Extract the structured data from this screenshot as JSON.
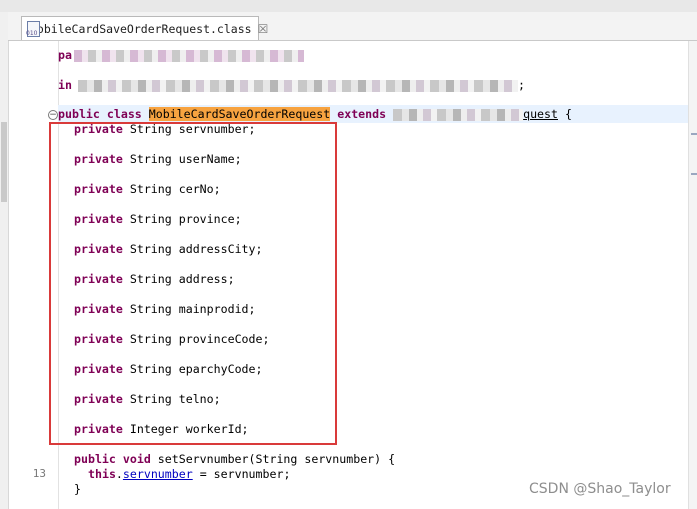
{
  "tab": {
    "label": "MobileCardSaveOrderRequest.class",
    "close_glyph": "☒"
  },
  "editor": {
    "line_package_start": "pa",
    "line_import_start": "in",
    "line_import_end": ";",
    "class_line": {
      "kw_public": "public",
      "kw_class": "class",
      "class_name": "MobileCardSaveOrderRequest",
      "kw_extends": "extends",
      "super_suffix": "quest",
      "brace": "{"
    },
    "fields": [
      {
        "mod": "private",
        "type": "String",
        "name": "servnumber;"
      },
      {
        "mod": "private",
        "type": "String",
        "name": "userName;"
      },
      {
        "mod": "private",
        "type": "String",
        "name": "cerNo;"
      },
      {
        "mod": "private",
        "type": "String",
        "name": "province;"
      },
      {
        "mod": "private",
        "type": "String",
        "name": "addressCity;"
      },
      {
        "mod": "private",
        "type": "String",
        "name": "address;"
      },
      {
        "mod": "private",
        "type": "String",
        "name": "mainprodid;"
      },
      {
        "mod": "private",
        "type": "String",
        "name": "provinceCode;"
      },
      {
        "mod": "private",
        "type": "String",
        "name": "eparchyCode;"
      },
      {
        "mod": "private",
        "type": "String",
        "name": "telno;"
      },
      {
        "mod": "private",
        "type": "Integer",
        "name": "workerId;"
      }
    ],
    "method_line": {
      "kw_public": "public",
      "kw_void": "void",
      "rest": "setServnumber(String servnumber) {"
    },
    "assign_line": {
      "kw_this": "this",
      "dot": ".",
      "field": "servnumber",
      "rest": " = servnumber;"
    },
    "close_brace": "}",
    "line_number": "13"
  },
  "watermark": "CSDN @Shao_Taylor",
  "colors": {
    "keyword": "#7f0055",
    "highlight": "#f7a340",
    "annotation_box": "#d93a3a",
    "field": "#0000c0"
  }
}
